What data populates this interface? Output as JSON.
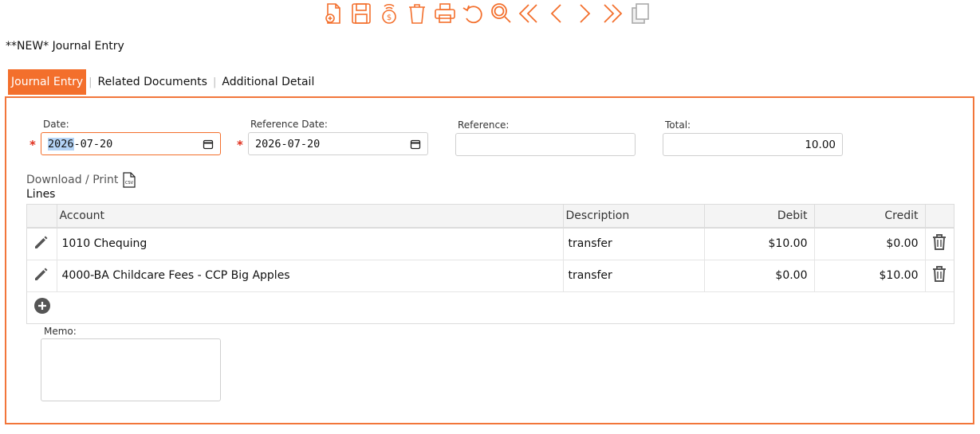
{
  "toolbar": {
    "icons": [
      "new-document-icon",
      "save-icon",
      "money-icon",
      "trash-icon",
      "print-icon",
      "undo-icon",
      "search-icon",
      "first-icon",
      "previous-icon",
      "next-icon",
      "last-icon",
      "copy-icon"
    ],
    "accent": "#f36f2c"
  },
  "page": {
    "title": "**NEW* Journal Entry"
  },
  "tabs": [
    {
      "label": "Journal Entry",
      "active": true
    },
    {
      "label": "Related Documents",
      "active": false
    },
    {
      "label": "Additional Detail",
      "active": false
    }
  ],
  "form": {
    "date": {
      "label": "Date:",
      "value_year": "2026",
      "value_rest": "-07-20"
    },
    "reference_date": {
      "label": "Reference Date:",
      "value": "2026-07-20"
    },
    "reference": {
      "label": "Reference:",
      "value": ""
    },
    "total": {
      "label": "Total:",
      "value": "10.00"
    },
    "required_marker": "*"
  },
  "download_print": "Download / Print",
  "lines_label": "Lines",
  "grid": {
    "headers": {
      "account": "Account",
      "description": "Description",
      "debit": "Debit",
      "credit": "Credit"
    },
    "rows": [
      {
        "account": "1010 Chequing",
        "description": "transfer",
        "debit": "$10.00",
        "credit": "$0.00"
      },
      {
        "account": "4000-BA Childcare Fees - CCP Big Apples",
        "description": "transfer",
        "debit": "$0.00",
        "credit": "$10.00"
      }
    ]
  },
  "memo": {
    "label": "Memo:",
    "value": ""
  }
}
